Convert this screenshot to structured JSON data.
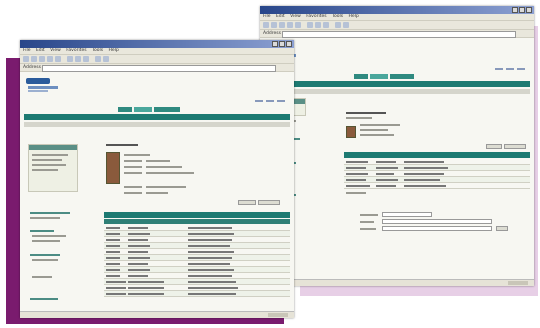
{
  "colors": {
    "purple": "#7a1b6e",
    "pink": "#e7cfe6",
    "teal": "#1d7a72",
    "titlebar": "#28468a"
  },
  "back_window": {
    "title": "",
    "menu": [
      "File",
      "Edit",
      "View",
      "Favorites",
      "Tools",
      "Help"
    ],
    "address_label": "Address",
    "tabs": [
      "",
      "",
      ""
    ],
    "banner": "",
    "detail_section": "",
    "form_labels": [
      "",
      "",
      ""
    ],
    "go_label": ""
  },
  "front_window": {
    "title": "",
    "menu": [
      "File",
      "Edit",
      "View",
      "Favorites",
      "Tools",
      "Help"
    ],
    "address_label": "Address",
    "tabs": [
      "",
      "",
      ""
    ],
    "banner": "",
    "table_header": ""
  }
}
